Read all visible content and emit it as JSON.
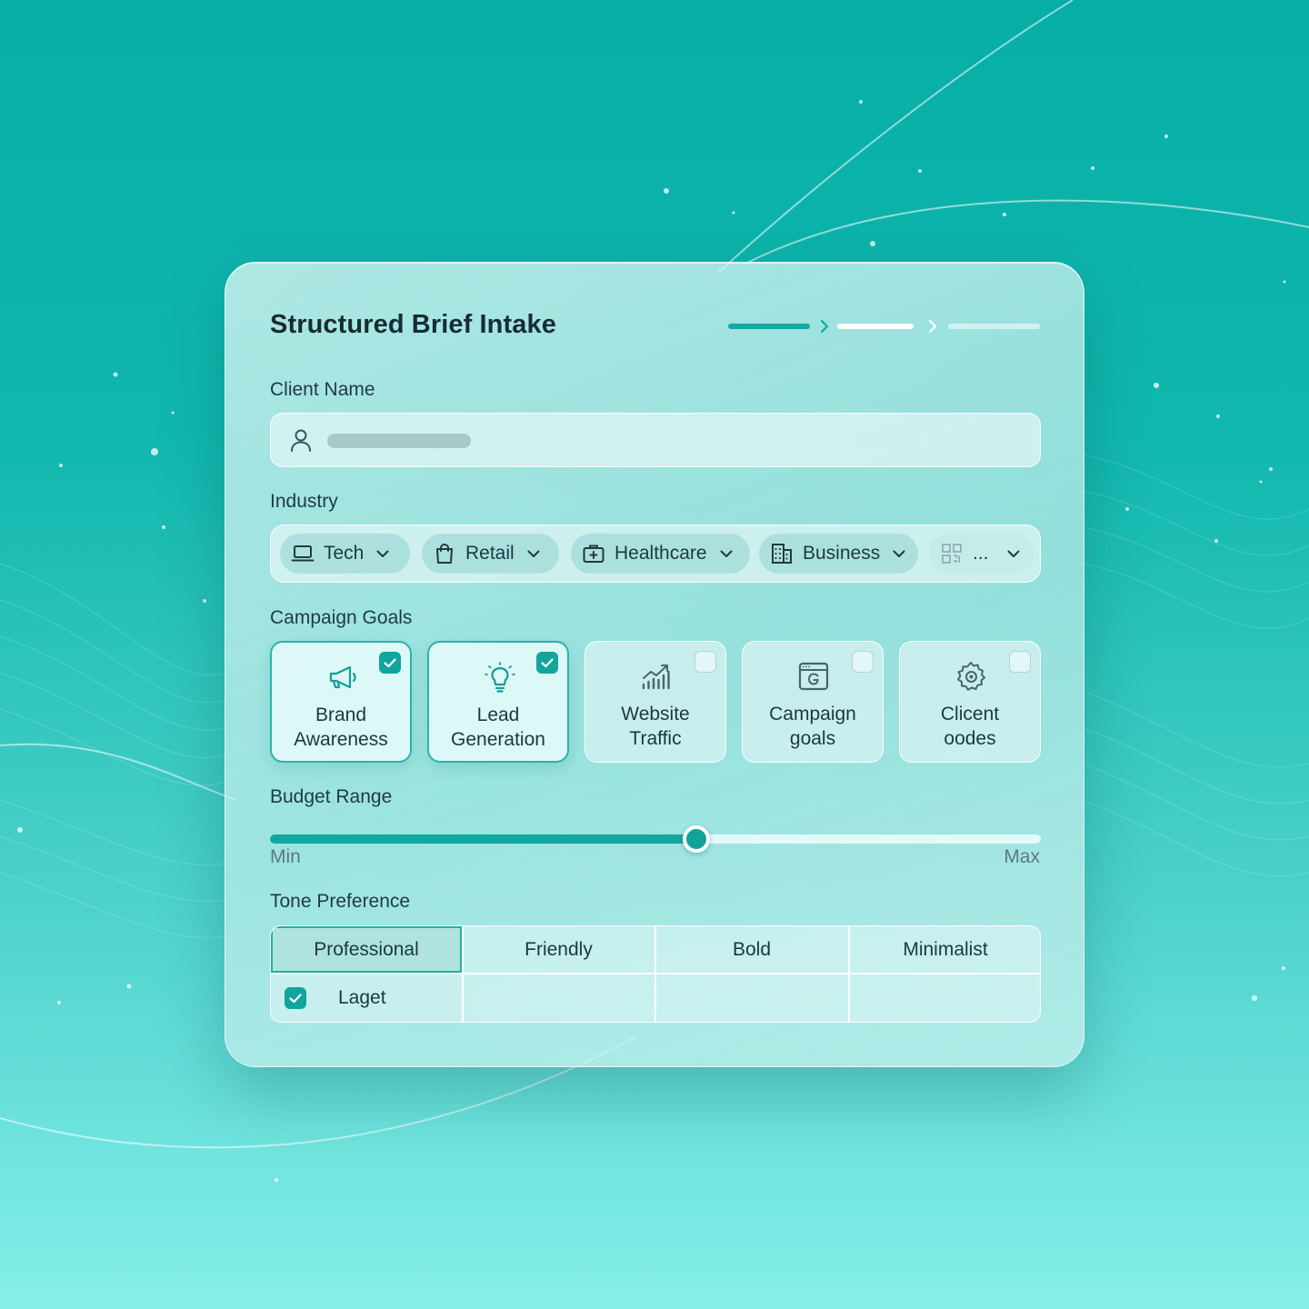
{
  "form": {
    "title": "Structured Brief Intake",
    "stepper": {
      "total_steps": 3,
      "current_step": 2
    },
    "client_name": {
      "label": "Client Name"
    },
    "industry": {
      "label": "Industry",
      "options": [
        {
          "label": "Tech",
          "icon": "laptop-icon"
        },
        {
          "label": "Retail",
          "icon": "shopping-bag-icon"
        },
        {
          "label": "Healthcare",
          "icon": "medical-kit-icon"
        },
        {
          "label": "Business",
          "icon": "building-icon"
        },
        {
          "label": "...",
          "icon": "qr-code-icon"
        }
      ]
    },
    "campaign_goals": {
      "label": "Campaign Goals",
      "items": [
        {
          "line1": "Brand",
          "line2": "Awareness",
          "icon": "megaphone-icon",
          "checked": true
        },
        {
          "line1": "Lead",
          "line2": "Generation",
          "icon": "lightbulb-icon",
          "checked": true
        },
        {
          "line1": "Website",
          "line2": "Traffic",
          "icon": "chart-growth-icon",
          "checked": false
        },
        {
          "line1": "Campaign",
          "line2": "goals",
          "icon": "browser-window-icon",
          "checked": false
        },
        {
          "line1": "Clicent",
          "line2": "oodes",
          "icon": "gear-icon",
          "checked": false
        }
      ]
    },
    "budget": {
      "label": "Budget Range",
      "min_label": "Min",
      "max_label": "Max",
      "value_fraction": 0.553
    },
    "tone": {
      "label": "Tone Preference",
      "columns": [
        "Professional",
        "Friendly",
        "Bold",
        "Minimalist"
      ],
      "selected_index": 0,
      "row_label": "Laget",
      "row_checked": true
    }
  },
  "colors": {
    "accent": "#11a8a0",
    "background_top": "#06aea6",
    "background_bottom": "#86efe9"
  }
}
